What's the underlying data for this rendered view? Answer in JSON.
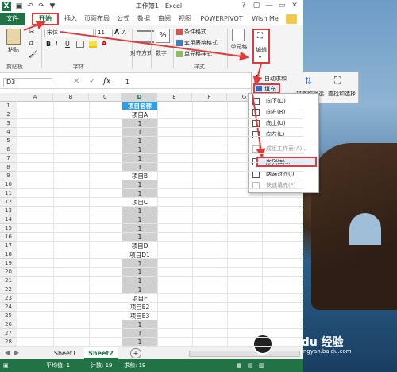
{
  "window": {
    "title": "工作簿1 - Excel",
    "qat_icons": [
      "excel-logo-icon",
      "save-icon",
      "undo-icon",
      "redo-icon",
      "filter-icon"
    ],
    "controls": [
      "?",
      "▢",
      "—",
      "▭",
      "✕"
    ]
  },
  "tabs": [
    "文件",
    "开始",
    "插入",
    "页面布局",
    "公式",
    "数据",
    "审阅",
    "视图",
    "POWERPIVOT",
    "Wish Me"
  ],
  "ribbon": {
    "clipboard": {
      "paste": "粘贴",
      "label": "剪贴板"
    },
    "font": {
      "name": "宋体",
      "size": "11",
      "bold": "B",
      "italic": "I",
      "underline": "U",
      "grow": "A",
      "shrink": "A",
      "label": "字体"
    },
    "alignment": {
      "label": "对齐方式"
    },
    "number": {
      "percent": "%",
      "label": "数字"
    },
    "styles": {
      "conditional": "条件格式",
      "table": "套用表格格式",
      "cell": "单元格样式",
      "label": "样式"
    },
    "cells": {
      "label": "单元格"
    },
    "editing": {
      "label": "编辑"
    }
  },
  "formula_bar": {
    "name_box": "D3",
    "fx": "fx",
    "value": "1"
  },
  "columns": [
    "A",
    "B",
    "C",
    "D",
    "E",
    "F",
    "G"
  ],
  "rows": [
    {
      "n": "1",
      "d": "项目名称"
    },
    {
      "n": "2",
      "d": "项目A"
    },
    {
      "n": "3",
      "d": "1"
    },
    {
      "n": "4",
      "d": "1"
    },
    {
      "n": "5",
      "d": "1"
    },
    {
      "n": "6",
      "d": "1"
    },
    {
      "n": "7",
      "d": "1"
    },
    {
      "n": "8",
      "d": "1"
    },
    {
      "n": "9",
      "d": "项目B"
    },
    {
      "n": "10",
      "d": "1"
    },
    {
      "n": "11",
      "d": "1"
    },
    {
      "n": "12",
      "d": "项目C"
    },
    {
      "n": "13",
      "d": "1"
    },
    {
      "n": "14",
      "d": "1"
    },
    {
      "n": "15",
      "d": "1"
    },
    {
      "n": "16",
      "d": "1"
    },
    {
      "n": "17",
      "d": "项目D"
    },
    {
      "n": "18",
      "d": "项目D1"
    },
    {
      "n": "19",
      "d": "1"
    },
    {
      "n": "20",
      "d": "1"
    },
    {
      "n": "21",
      "d": "1"
    },
    {
      "n": "22",
      "d": "1"
    },
    {
      "n": "23",
      "d": "项目E"
    },
    {
      "n": "24",
      "d": "项目E2"
    },
    {
      "n": "25",
      "d": "项目E3"
    },
    {
      "n": "26",
      "d": "1"
    },
    {
      "n": "27",
      "d": "1"
    },
    {
      "n": "28",
      "d": "1"
    }
  ],
  "sheets": [
    "Sheet1",
    "Sheet2"
  ],
  "add_sheet": "+",
  "status": {
    "average": "平均值: 1",
    "count": "计数: 19",
    "sum": "求和: 19"
  },
  "edit_panel": {
    "autosum": "自动求和",
    "fill": "填充",
    "clear": "清除",
    "sort_filter": "排序和筛选",
    "find_select": "查找和选择"
  },
  "fill_menu": [
    {
      "label": "向下(D)",
      "disabled": false
    },
    {
      "label": "向右(R)",
      "disabled": false
    },
    {
      "label": "向上(U)",
      "disabled": false
    },
    {
      "label": "向左(L)",
      "disabled": false
    },
    {
      "label": "成组工作表(A)...",
      "disabled": true
    },
    {
      "label": "序列(S)...",
      "disabled": false
    },
    {
      "label": "两端对齐(J)",
      "disabled": false
    },
    {
      "label": "快速填充(F)",
      "disabled": true
    }
  ],
  "watermark": "Bai du 经验",
  "watermark_sub": "jingyan.baidu.com",
  "colors": {
    "excel_green": "#217346",
    "highlight_red": "#e03b3b",
    "selected_fill": "#cfcfcf",
    "header_fill": "#2e9fe6"
  }
}
